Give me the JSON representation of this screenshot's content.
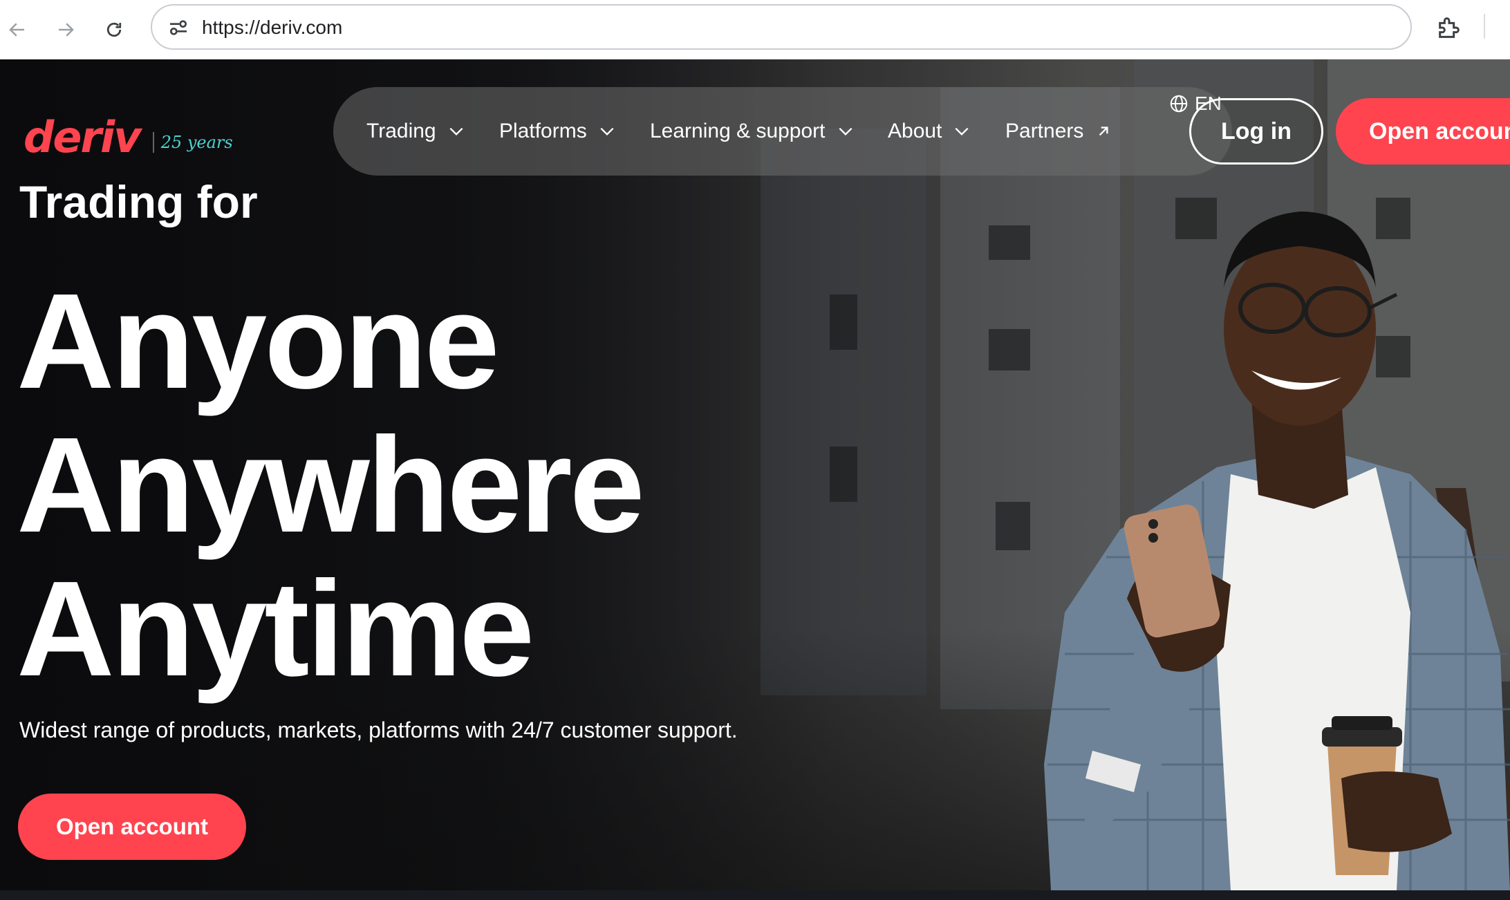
{
  "browser": {
    "url": "https://deriv.com",
    "back_icon": "back-arrow-icon",
    "forward_icon": "forward-arrow-icon",
    "reload_icon": "reload-icon",
    "site_info_icon": "tune-icon",
    "extensions_icon": "puzzle-icon"
  },
  "header": {
    "logo_text": "deriv",
    "logo_years": "25 years",
    "nav": [
      {
        "label": "Trading",
        "icon": "chevron-down-icon"
      },
      {
        "label": "Platforms",
        "icon": "chevron-down-icon"
      },
      {
        "label": "Learning & support",
        "icon": "chevron-down-icon"
      },
      {
        "label": "About",
        "icon": "chevron-down-icon"
      },
      {
        "label": "Partners",
        "icon": "arrow-up-right-icon"
      }
    ],
    "language": "EN",
    "language_icon": "globe-icon",
    "login_label": "Log in",
    "open_account_label": "Open account"
  },
  "hero": {
    "eyebrow": "Trading for",
    "lines": [
      "Anyone",
      "Anywhere",
      "Anytime"
    ],
    "subtitle": "Widest range of products, markets, platforms with 24/7 customer support.",
    "cta_label": "Open account"
  },
  "colors": {
    "brand_red": "#ff444f",
    "years_teal": "#4ad5d0",
    "text_white": "#ffffff"
  }
}
